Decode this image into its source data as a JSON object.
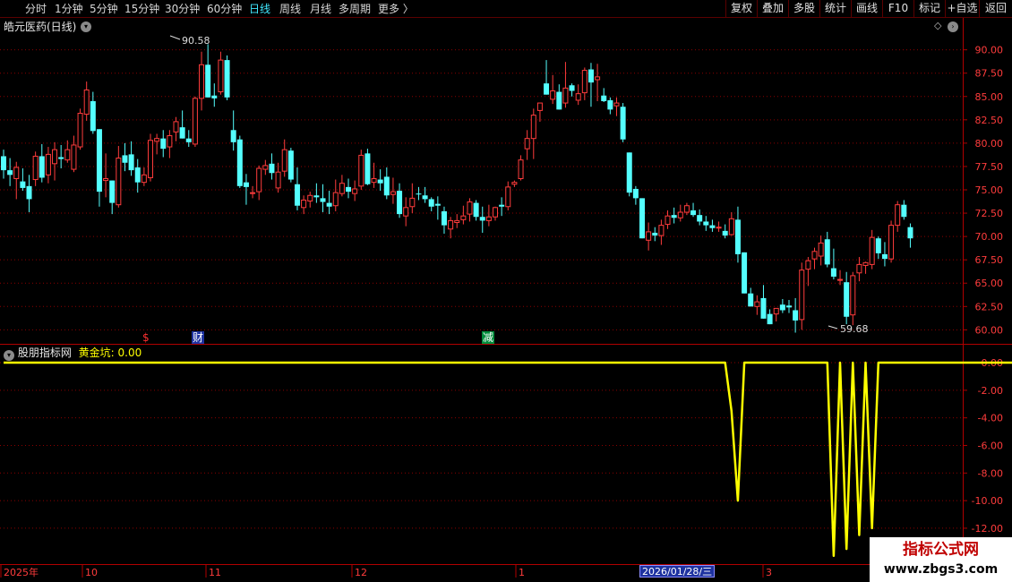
{
  "toolbar": {
    "periods": [
      "分时",
      "1分钟",
      "5分钟",
      "15分钟",
      "30分钟",
      "60分钟",
      "日线",
      "周线",
      "月线",
      "多周期",
      "更多 〉"
    ],
    "active_period": "日线",
    "buttons": [
      "复权",
      "叠加",
      "多股",
      "统计",
      "画线",
      "F10",
      "标记",
      "+自选",
      "返回"
    ]
  },
  "stock": {
    "title": "皓元医药(日线)"
  },
  "price_axis": {
    "ticks": [
      "90.00",
      "87.50",
      "85.00",
      "82.50",
      "80.00",
      "77.50",
      "75.00",
      "72.50",
      "70.00",
      "67.50",
      "65.00",
      "62.50",
      "60.00"
    ]
  },
  "indicator": {
    "name": "股朋指标网",
    "series_label": "黄金坑:",
    "current_value": "0.00",
    "axis_ticks": [
      "0.00",
      "-2.00",
      "-4.00",
      "-6.00",
      "-8.00",
      "-10.00",
      "-12.00"
    ]
  },
  "markers": {
    "s": "$",
    "cai": "财",
    "jian": "减"
  },
  "annotations": {
    "high": "90.58",
    "low": "59.68"
  },
  "date_axis": {
    "labels": [
      "2025年",
      "10",
      "11",
      "12",
      "1",
      "3"
    ],
    "cursor_date": "2026/01/28/三"
  },
  "watermark": {
    "name": "指标公式网",
    "url": "www.zbgs3.com"
  },
  "colors": {
    "up": "#ff3c3c",
    "down": "#54ffff",
    "indicator": "#ffff00",
    "grid": "#8b0000"
  },
  "chart_data": [
    {
      "type": "candlestick",
      "title": "皓元医药(日线)",
      "ylim": [
        58.5,
        91.5
      ],
      "candles": [
        [
          78.6,
          79.3,
          76.2,
          77.1
        ],
        [
          77.1,
          78.4,
          75.4,
          76.6
        ],
        [
          76.2,
          78.0,
          74.0,
          77.4
        ],
        [
          75.9,
          77.3,
          74.9,
          75.2
        ],
        [
          75.4,
          76.6,
          72.6,
          74.0
        ],
        [
          76.1,
          79.1,
          75.4,
          78.6
        ],
        [
          78.6,
          79.9,
          75.8,
          76.3
        ],
        [
          76.6,
          79.6,
          75.7,
          78.8
        ],
        [
          77.8,
          80.1,
          76.0,
          79.3
        ],
        [
          78.5,
          79.8,
          77.3,
          78.3
        ],
        [
          78.2,
          80.3,
          77.9,
          79.3
        ],
        [
          77.2,
          80.8,
          76.9,
          79.8
        ],
        [
          79.6,
          83.7,
          79.3,
          83.2
        ],
        [
          83.1,
          86.6,
          82.4,
          85.7
        ],
        [
          84.5,
          85.5,
          81.0,
          81.3
        ],
        [
          81.5,
          79.6,
          73.2,
          74.8
        ],
        [
          76.0,
          78.9,
          74.2,
          76.2
        ],
        [
          76.0,
          76.0,
          72.4,
          73.6
        ],
        [
          73.4,
          79.7,
          73.1,
          78.4
        ],
        [
          78.7,
          80.0,
          77.0,
          77.9
        ],
        [
          78.8,
          80.2,
          76.5,
          77.1
        ],
        [
          77.4,
          78.3,
          74.7,
          75.8
        ],
        [
          75.8,
          77.4,
          75.4,
          76.6
        ],
        [
          76.3,
          81.0,
          75.9,
          80.3
        ],
        [
          80.2,
          81.0,
          78.8,
          80.5
        ],
        [
          80.5,
          81.4,
          78.5,
          79.4
        ],
        [
          79.6,
          81.4,
          78.4,
          80.8
        ],
        [
          81.2,
          82.8,
          80.2,
          82.3
        ],
        [
          81.7,
          83.5,
          80.8,
          80.5
        ],
        [
          80.5,
          81.4,
          79.6,
          80.1
        ],
        [
          79.9,
          85.0,
          79.6,
          84.8
        ],
        [
          84.8,
          89.8,
          83.5,
          88.4
        ],
        [
          88.4,
          90.6,
          84.9,
          84.9
        ],
        [
          85.1,
          86.4,
          83.9,
          84.8
        ],
        [
          85.5,
          89.8,
          85.2,
          88.9
        ],
        [
          88.9,
          89.4,
          84.6,
          84.9
        ],
        [
          81.4,
          83.5,
          79.2,
          80.1
        ],
        [
          80.4,
          80.8,
          75.2,
          75.4
        ],
        [
          75.8,
          76.7,
          73.4,
          75.3
        ],
        [
          74.6,
          75.4,
          74.1,
          74.7
        ],
        [
          74.8,
          77.6,
          73.9,
          77.3
        ],
        [
          77.2,
          78.2,
          76.6,
          77.6
        ],
        [
          77.8,
          78.9,
          76.1,
          76.8
        ],
        [
          75.2,
          77.9,
          74.7,
          76.9
        ],
        [
          77.0,
          80.4,
          76.4,
          79.3
        ],
        [
          79.2,
          79.5,
          75.8,
          76.1
        ],
        [
          75.6,
          77.4,
          72.8,
          73.3
        ],
        [
          73.1,
          74.4,
          72.4,
          73.9
        ],
        [
          73.8,
          74.8,
          73.1,
          74.4
        ],
        [
          74.4,
          75.7,
          73.6,
          74.2
        ],
        [
          74.1,
          75.6,
          72.6,
          73.7
        ],
        [
          73.6,
          74.9,
          72.4,
          73.2
        ],
        [
          73.3,
          76.1,
          72.7,
          74.7
        ],
        [
          74.6,
          76.6,
          74.3,
          75.7
        ],
        [
          75.3,
          76.2,
          74.1,
          74.8
        ],
        [
          74.6,
          76.0,
          73.8,
          75.1
        ],
        [
          75.4,
          79.3,
          75.0,
          78.7
        ],
        [
          78.9,
          79.4,
          75.5,
          75.6
        ],
        [
          75.8,
          77.9,
          75.2,
          76.2
        ],
        [
          76.1,
          77.2,
          74.9,
          75.7
        ],
        [
          76.4,
          77.4,
          74.0,
          74.4
        ],
        [
          74.5,
          76.3,
          73.5,
          74.8
        ],
        [
          74.9,
          75.7,
          72.0,
          72.4
        ],
        [
          72.2,
          74.2,
          71.1,
          73.1
        ],
        [
          73.2,
          75.7,
          72.5,
          74.1
        ],
        [
          74.6,
          75.3,
          73.9,
          74.5
        ],
        [
          74.4,
          75.3,
          73.6,
          74.0
        ],
        [
          74.0,
          74.2,
          72.7,
          73.2
        ],
        [
          73.5,
          74.3,
          71.8,
          73.3
        ],
        [
          72.7,
          73.2,
          70.3,
          71.2
        ],
        [
          70.8,
          72.1,
          69.8,
          71.7
        ],
        [
          71.5,
          72.4,
          70.9,
          71.7
        ],
        [
          71.8,
          73.3,
          71.3,
          72.2
        ],
        [
          72.4,
          74.1,
          71.6,
          73.7
        ],
        [
          73.6,
          73.9,
          71.7,
          72.1
        ],
        [
          72.1,
          73.2,
          70.4,
          71.7
        ],
        [
          71.7,
          73.4,
          71.1,
          72.1
        ],
        [
          72.1,
          73.2,
          71.7,
          73.1
        ],
        [
          73.4,
          74.2,
          72.2,
          73.2
        ],
        [
          73.2,
          75.9,
          72.8,
          75.3
        ],
        [
          75.6,
          76.0,
          75.3,
          75.8
        ],
        [
          76.2,
          78.7,
          76.0,
          78.2
        ],
        [
          79.4,
          81.4,
          78.2,
          80.5
        ],
        [
          80.5,
          83.7,
          78.3,
          83.0
        ],
        [
          83.5,
          84.2,
          82.3,
          84.3
        ],
        [
          86.4,
          88.9,
          86.2,
          85.2
        ],
        [
          84.7,
          87.3,
          84.2,
          85.6
        ],
        [
          85.5,
          86.3,
          83.8,
          83.6
        ],
        [
          84.3,
          88.7,
          83.8,
          85.9
        ],
        [
          86.2,
          86.4,
          85.0,
          85.6
        ],
        [
          84.6,
          86.3,
          84.1,
          85.3
        ],
        [
          85.4,
          88.1,
          84.6,
          87.8
        ],
        [
          87.9,
          88.6,
          83.9,
          86.5
        ],
        [
          86.8,
          88.5,
          84.5,
          87.1
        ],
        [
          85.1,
          85.9,
          84.4,
          84.5
        ],
        [
          84.6,
          84.9,
          83.1,
          83.6
        ],
        [
          84.0,
          84.9,
          82.9,
          84.3
        ],
        [
          83.9,
          84.3,
          80.1,
          80.4
        ],
        [
          79.0,
          78.7,
          74.3,
          74.7
        ],
        [
          75.1,
          75.4,
          73.4,
          74.1
        ],
        [
          74.1,
          74.1,
          69.9,
          69.8
        ],
        [
          69.6,
          71.5,
          68.5,
          70.5
        ],
        [
          70.4,
          71.0,
          69.5,
          70.1
        ],
        [
          70.1,
          71.8,
          69.1,
          71.2
        ],
        [
          71.3,
          72.8,
          70.8,
          72.2
        ],
        [
          72.3,
          73.1,
          71.4,
          72.0
        ],
        [
          72.0,
          73.4,
          71.6,
          72.6
        ],
        [
          72.6,
          73.6,
          72.3,
          73.3
        ],
        [
          72.8,
          73.6,
          72.1,
          72.3
        ],
        [
          72.3,
          72.9,
          71.2,
          71.6
        ],
        [
          71.6,
          72.2,
          70.6,
          71.2
        ],
        [
          71.2,
          71.8,
          70.5,
          70.9
        ],
        [
          70.9,
          71.6,
          70.5,
          71.0
        ],
        [
          70.6,
          71.3,
          69.8,
          70.1
        ],
        [
          70.2,
          72.6,
          70.1,
          71.9
        ],
        [
          71.8,
          73.2,
          67.2,
          68.1
        ],
        [
          68.3,
          67.2,
          65.6,
          63.9
        ],
        [
          63.9,
          64.5,
          63.4,
          62.5
        ],
        [
          62.5,
          63.7,
          61.6,
          63.0
        ],
        [
          63.4,
          64.8,
          62.1,
          61.2
        ],
        [
          61.7,
          62.2,
          60.8,
          60.6
        ],
        [
          61.7,
          62.1,
          60.9,
          62.3
        ],
        [
          62.7,
          63.3,
          61.8,
          62.1
        ],
        [
          62.6,
          63.2,
          61.8,
          62.4
        ],
        [
          62.1,
          63.4,
          59.7,
          61.0
        ],
        [
          61.1,
          67.2,
          60.0,
          66.4
        ],
        [
          66.5,
          67.8,
          64.7,
          67.4
        ],
        [
          67.6,
          68.8,
          66.5,
          68.4
        ],
        [
          67.9,
          70.1,
          66.9,
          69.3
        ],
        [
          69.7,
          70.5,
          66.7,
          67.0
        ],
        [
          66.6,
          68.7,
          65.4,
          65.7
        ],
        [
          65.3,
          66.4,
          64.8,
          65.4
        ],
        [
          65.1,
          66.2,
          60.6,
          61.4
        ],
        [
          61.6,
          66.2,
          60.5,
          65.8
        ],
        [
          66.1,
          67.8,
          65.2,
          67.0
        ],
        [
          66.9,
          67.3,
          66.0,
          67.2
        ],
        [
          67.0,
          70.7,
          66.5,
          69.9
        ],
        [
          69.8,
          70.0,
          67.6,
          68.2
        ],
        [
          68.1,
          69.4,
          66.8,
          67.6
        ],
        [
          67.6,
          71.7,
          67.2,
          71.2
        ],
        [
          71.2,
          73.8,
          70.5,
          73.4
        ],
        [
          73.4,
          73.9,
          71.8,
          72.1
        ],
        [
          71.0,
          71.4,
          68.8,
          69.8
        ]
      ]
    },
    {
      "type": "line",
      "title": "股朋指标网",
      "series": [
        {
          "name": "黄金坑",
          "values": [
            0,
            0,
            0,
            0,
            0,
            0,
            0,
            0,
            0,
            0,
            0,
            0,
            0,
            0,
            0,
            0,
            0,
            0,
            0,
            0,
            0,
            0,
            0,
            0,
            0,
            0,
            0,
            0,
            0,
            0,
            0,
            0,
            0,
            0,
            0,
            0,
            0,
            0,
            0,
            0,
            0,
            0,
            0,
            0,
            0,
            0,
            0,
            0,
            0,
            0,
            0,
            0,
            0,
            0,
            0,
            0,
            0,
            0,
            0,
            0,
            0,
            0,
            0,
            0,
            0,
            0,
            0,
            0,
            0,
            0,
            0,
            0,
            0,
            0,
            0,
            0,
            0,
            0,
            0,
            0,
            0,
            0,
            0,
            0,
            0,
            0,
            0,
            0,
            0,
            0,
            0,
            0,
            0,
            0,
            0,
            0,
            0,
            0,
            0,
            0,
            0,
            0,
            0,
            0,
            0,
            0,
            0,
            0,
            0,
            0,
            0,
            0,
            0,
            0,
            -3.5,
            -10.0,
            0,
            0,
            0,
            0,
            0,
            0,
            0,
            0,
            0,
            0,
            0,
            0,
            0,
            0,
            -14.0,
            0,
            -13.5,
            0,
            -12.5,
            0,
            -12.0,
            0,
            0,
            0,
            0,
            0,
            0,
            0,
            0,
            0,
            0,
            0,
            0,
            0,
            0,
            0,
            0,
            0,
            0,
            0,
            0,
            0,
            0,
            0,
            0,
            0,
            0,
            0,
            0,
            0,
            0,
            0,
            0,
            0,
            0,
            0
          ]
        }
      ],
      "ylim": [
        -14.6,
        1.3
      ]
    }
  ]
}
